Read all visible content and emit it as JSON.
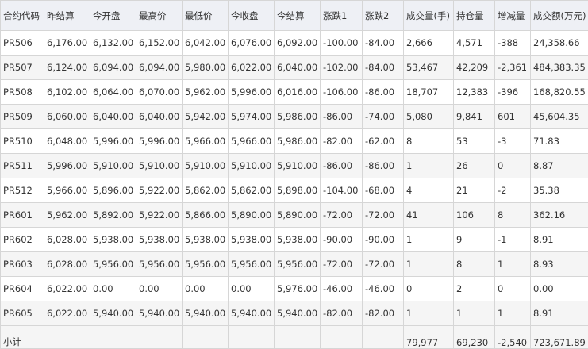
{
  "headers": [
    "合约代码",
    "昨结算",
    "今开盘",
    "最高价",
    "最低价",
    "今收盘",
    "今结算",
    "涨跌1",
    "涨跌2",
    "成交量(手)",
    "持仓量",
    "增减量",
    "成交额(万元)"
  ],
  "rows": [
    [
      "PR506",
      "6,176.00",
      "6,132.00",
      "6,152.00",
      "6,042.00",
      "6,076.00",
      "6,092.00",
      "-100.00",
      "-84.00",
      "2,666",
      "4,571",
      "-388",
      "24,358.66"
    ],
    [
      "PR507",
      "6,124.00",
      "6,094.00",
      "6,094.00",
      "5,980.00",
      "6,022.00",
      "6,040.00",
      "-102.00",
      "-84.00",
      "53,467",
      "42,209",
      "-2,361",
      "484,383.35"
    ],
    [
      "PR508",
      "6,102.00",
      "6,064.00",
      "6,070.00",
      "5,962.00",
      "5,996.00",
      "6,016.00",
      "-106.00",
      "-86.00",
      "18,707",
      "12,383",
      "-396",
      "168,820.55"
    ],
    [
      "PR509",
      "6,060.00",
      "6,040.00",
      "6,040.00",
      "5,942.00",
      "5,974.00",
      "5,986.00",
      "-86.00",
      "-74.00",
      "5,080",
      "9,841",
      "601",
      "45,604.35"
    ],
    [
      "PR510",
      "6,048.00",
      "5,996.00",
      "5,996.00",
      "5,966.00",
      "5,966.00",
      "5,986.00",
      "-82.00",
      "-62.00",
      "8",
      "53",
      "-3",
      "71.83"
    ],
    [
      "PR511",
      "5,996.00",
      "5,910.00",
      "5,910.00",
      "5,910.00",
      "5,910.00",
      "5,910.00",
      "-86.00",
      "-86.00",
      "1",
      "26",
      "0",
      "8.87"
    ],
    [
      "PR512",
      "5,966.00",
      "5,896.00",
      "5,922.00",
      "5,862.00",
      "5,862.00",
      "5,898.00",
      "-104.00",
      "-68.00",
      "4",
      "21",
      "-2",
      "35.38"
    ],
    [
      "PR601",
      "5,962.00",
      "5,892.00",
      "5,922.00",
      "5,866.00",
      "5,890.00",
      "5,890.00",
      "-72.00",
      "-72.00",
      "41",
      "106",
      "8",
      "362.16"
    ],
    [
      "PR602",
      "6,028.00",
      "5,938.00",
      "5,938.00",
      "5,938.00",
      "5,938.00",
      "5,938.00",
      "-90.00",
      "-90.00",
      "1",
      "9",
      "-1",
      "8.91"
    ],
    [
      "PR603",
      "6,028.00",
      "5,956.00",
      "5,956.00",
      "5,956.00",
      "5,956.00",
      "5,956.00",
      "-72.00",
      "-72.00",
      "1",
      "8",
      "1",
      "8.93"
    ],
    [
      "PR604",
      "6,022.00",
      "0.00",
      "0.00",
      "0.00",
      "0.00",
      "5,976.00",
      "-46.00",
      "-46.00",
      "0",
      "2",
      "0",
      "0.00"
    ],
    [
      "PR605",
      "6,022.00",
      "5,940.00",
      "5,940.00",
      "5,940.00",
      "5,940.00",
      "5,940.00",
      "-82.00",
      "-82.00",
      "1",
      "1",
      "1",
      "8.91"
    ]
  ],
  "total": [
    "小计",
    "",
    "",
    "",
    "",
    "",
    "",
    "",
    "",
    "79,977",
    "69,230",
    "-2,540",
    "723,671.89"
  ]
}
